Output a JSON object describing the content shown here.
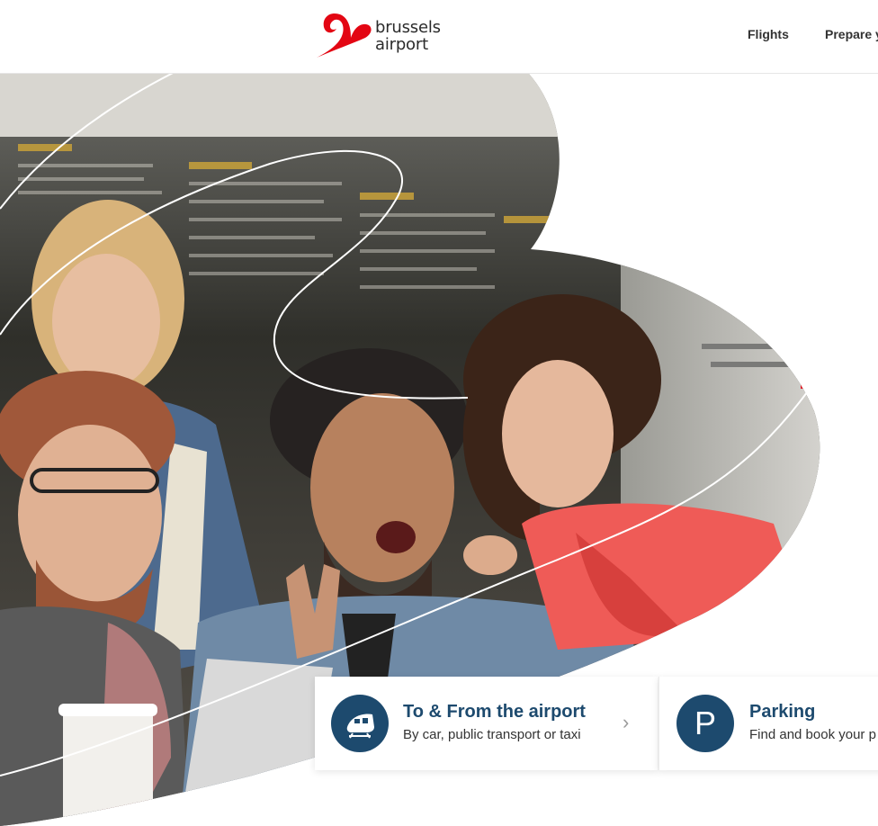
{
  "brand": {
    "name_line1": "brussels",
    "name_line2": "airport",
    "accent_color": "#e30613",
    "logo_icon": "brussels-airport-b-mark"
  },
  "nav": {
    "items": [
      {
        "label": "Flights"
      },
      {
        "label": "Prepare y"
      }
    ]
  },
  "hero": {
    "image_alt_icon": "hero-photo-friends-at-airport",
    "board_label": "Departures board"
  },
  "cards": [
    {
      "title": "To & From the airport",
      "subtitle": "By car, public transport or taxi",
      "icon": "train-icon",
      "chevron": "›"
    },
    {
      "title": "Parking",
      "subtitle": "Find and book your p",
      "icon": "parking-icon",
      "icon_letter": "P"
    }
  ],
  "colors": {
    "primary_dark_blue": "#1d4a6e",
    "text_dark": "#333333"
  }
}
